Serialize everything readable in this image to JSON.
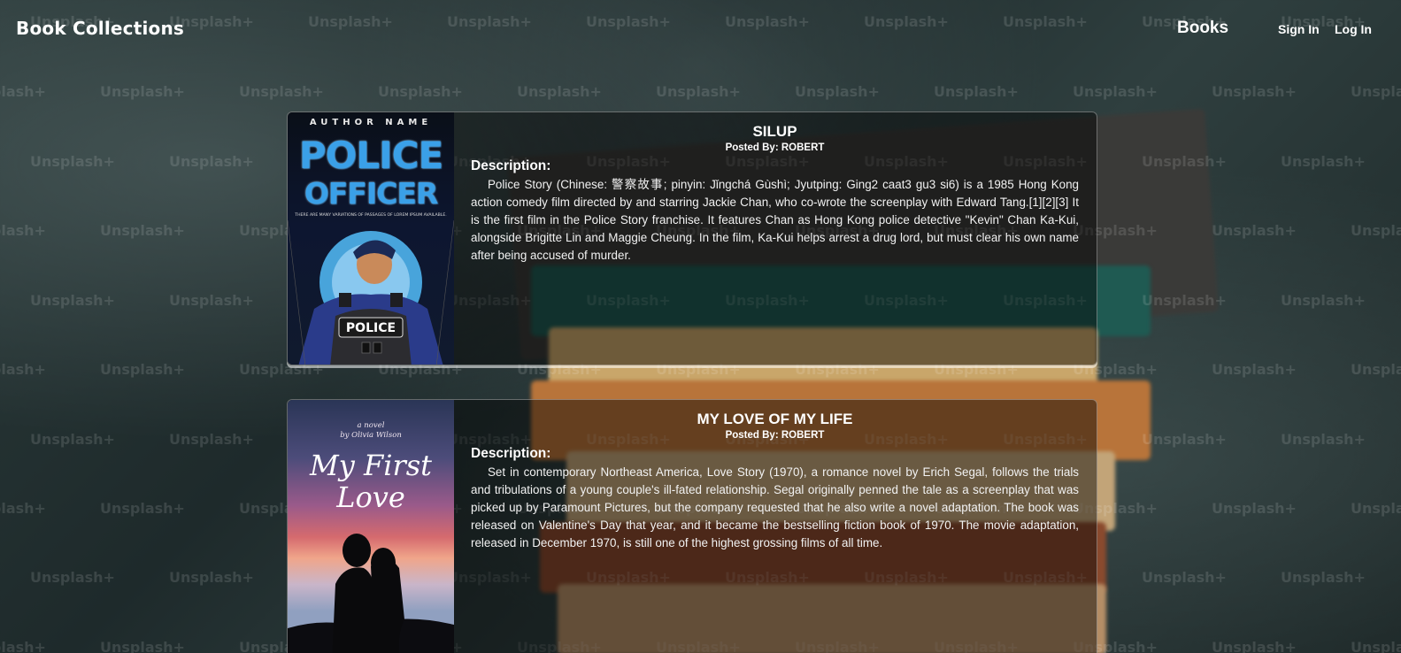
{
  "navbar": {
    "brand": "Book Collections",
    "books_link": "Books",
    "sign_in": "Sign In",
    "log_in": "Log In"
  },
  "watermark_text": "Unsplash+",
  "books": [
    {
      "title": "SILUP",
      "posted_by": "Posted By: ROBERT",
      "description_label": "Description:",
      "description": "Police Story (Chinese: 警察故事; pinyin: Jǐngchá Gùshì; Jyutping: Ging2 caat3 gu3 si6) is a 1985 Hong Kong action comedy film directed by and starring Jackie Chan, who co-wrote the screenplay with Edward Tang.[1][2][3] It is the first film in the Police Story franchise. It features Chan as Hong Kong police detective \"Kevin\" Chan Ka-Kui, alongside Brigitte Lin and Maggie Cheung. In the film, Ka-Kui helps arrest a drug lord, but must clear his own name after being accused of murder.",
      "cover": {
        "author": "AUTHOR NAME",
        "title_line1": "POLICE",
        "title_line2": "OFFICER",
        "tagline": "THERE ARE MANY VARIATIONS OF PASSAGES OF LOREM IPSUM AVAILABLE.",
        "badge": "POLICE"
      }
    },
    {
      "title": "MY LOVE OF MY LIFE",
      "posted_by": "Posted By: ROBERT",
      "description_label": "Description:",
      "description": "Set in contemporary Northeast America, Love Story (1970), a romance novel by Erich Segal, follows the trials and tribulations of a young couple's ill-fated relationship. Segal originally penned the tale as a screenplay that was picked up by Paramount Pictures, but the company requested that he also write a novel adaptation. The book was released on Valentine's Day that year, and it became the bestselling fiction book of 1970. The movie adaptation, released in December 1970, is still one of the highest grossing films of all time.",
      "cover": {
        "novel_line1": "a novel",
        "novel_line2": "by Olivia Wilson",
        "title_line1": "My First",
        "title_line2": "Love"
      }
    }
  ]
}
